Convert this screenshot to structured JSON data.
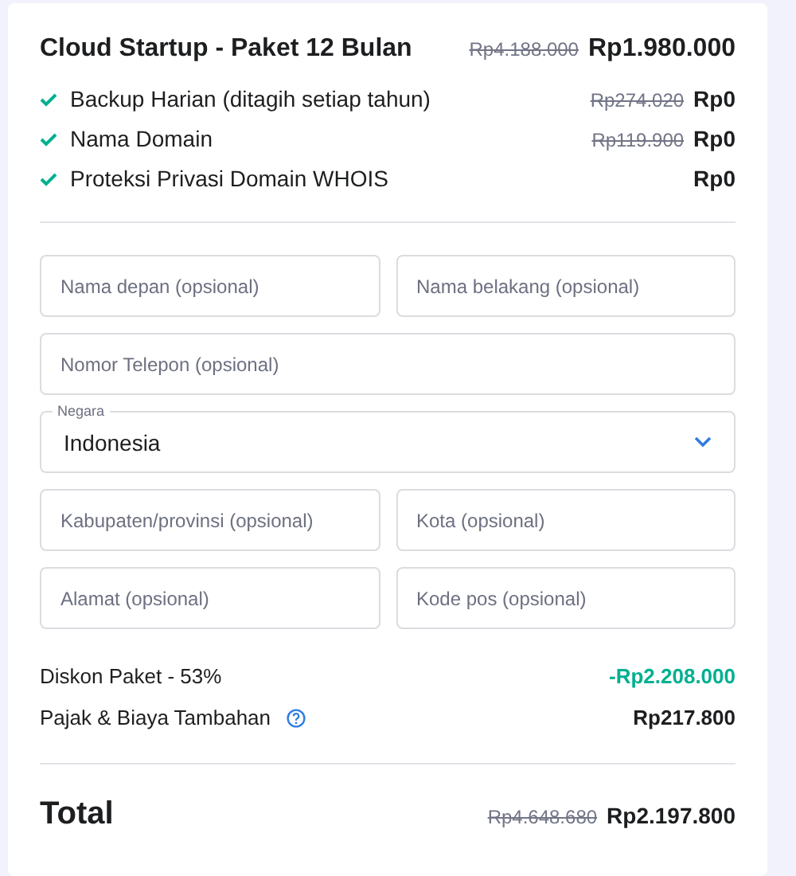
{
  "plan": {
    "name": "Cloud Startup - Paket 12 Bulan",
    "old_price": "Rp4.188.000",
    "price": "Rp1.980.000"
  },
  "features": [
    {
      "label": "Backup Harian (ditagih setiap tahun)",
      "old_price": "Rp274.020",
      "price": "Rp0"
    },
    {
      "label": "Nama Domain",
      "old_price": "Rp119.900",
      "price": "Rp0"
    },
    {
      "label": "Proteksi Privasi Domain WHOIS",
      "price": "Rp0"
    }
  ],
  "form": [
    {
      "kind": "half",
      "placeholder": "Nama depan (opsional)"
    },
    {
      "kind": "half",
      "placeholder": "Nama belakang (opsional)"
    },
    {
      "kind": "full",
      "placeholder": "Nomor Telepon (opsional)"
    },
    {
      "kind": "select",
      "label": "Negara",
      "value": "Indonesia"
    },
    {
      "kind": "half",
      "placeholder": "Kabupaten/provinsi (opsional)"
    },
    {
      "kind": "half",
      "placeholder": "Kota (opsional)"
    },
    {
      "kind": "half",
      "placeholder": "Alamat (opsional)"
    },
    {
      "kind": "half",
      "placeholder": "Kode pos (opsional)"
    }
  ],
  "summary": [
    {
      "kind": "discount",
      "label": "Diskon Paket - 53%",
      "value": "-Rp2.208.000"
    },
    {
      "kind": "fee",
      "label": "Pajak & Biaya Tambahan",
      "value": "Rp217.800",
      "help": true
    }
  ],
  "total": {
    "label": "Total",
    "old_price": "Rp4.648.680",
    "price": "Rp2.197.800"
  }
}
